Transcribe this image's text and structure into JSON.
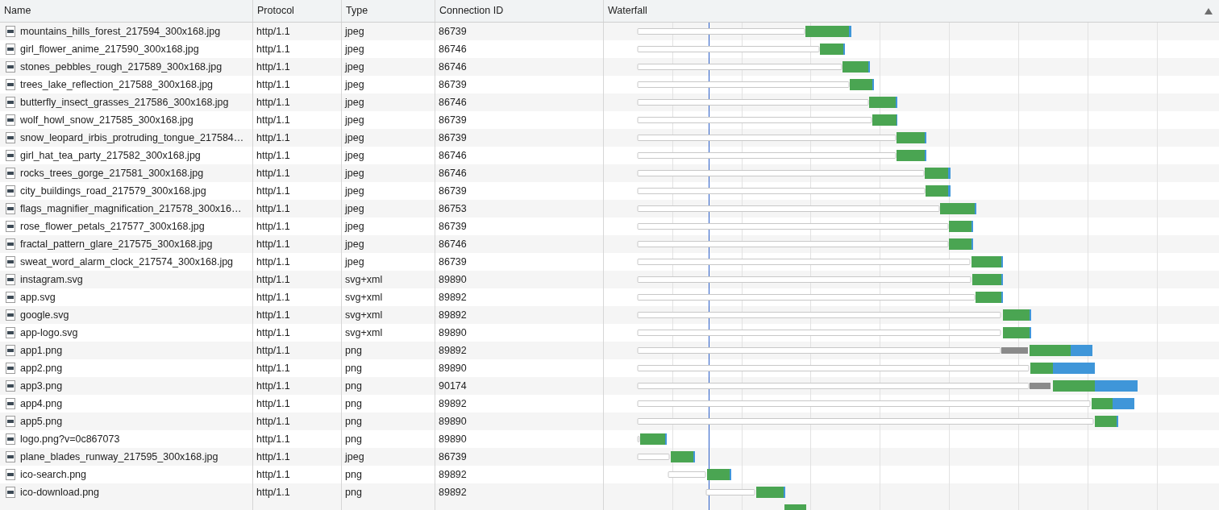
{
  "table": {
    "columns": [
      "Name",
      "Protocol",
      "Type",
      "Connection ID",
      "Waterfall"
    ],
    "sort_ascending": true,
    "rows": [
      {
        "name": "mountains_hills_forest_217594_300x168.jpg",
        "protocol": "http/1.1",
        "type": "jpeg",
        "connection_id": "86739"
      },
      {
        "name": "girl_flower_anime_217590_300x168.jpg",
        "protocol": "http/1.1",
        "type": "jpeg",
        "connection_id": "86746"
      },
      {
        "name": "stones_pebbles_rough_217589_300x168.jpg",
        "protocol": "http/1.1",
        "type": "jpeg",
        "connection_id": "86746"
      },
      {
        "name": "trees_lake_reflection_217588_300x168.jpg",
        "protocol": "http/1.1",
        "type": "jpeg",
        "connection_id": "86739"
      },
      {
        "name": "butterfly_insect_grasses_217586_300x168.jpg",
        "protocol": "http/1.1",
        "type": "jpeg",
        "connection_id": "86746"
      },
      {
        "name": "wolf_howl_snow_217585_300x168.jpg",
        "protocol": "http/1.1",
        "type": "jpeg",
        "connection_id": "86739"
      },
      {
        "name": "snow_leopard_irbis_protruding_tongue_217584…",
        "protocol": "http/1.1",
        "type": "jpeg",
        "connection_id": "86739"
      },
      {
        "name": "girl_hat_tea_party_217582_300x168.jpg",
        "protocol": "http/1.1",
        "type": "jpeg",
        "connection_id": "86746"
      },
      {
        "name": "rocks_trees_gorge_217581_300x168.jpg",
        "protocol": "http/1.1",
        "type": "jpeg",
        "connection_id": "86746"
      },
      {
        "name": "city_buildings_road_217579_300x168.jpg",
        "protocol": "http/1.1",
        "type": "jpeg",
        "connection_id": "86739"
      },
      {
        "name": "flags_magnifier_magnification_217578_300x16…",
        "protocol": "http/1.1",
        "type": "jpeg",
        "connection_id": "86753"
      },
      {
        "name": "rose_flower_petals_217577_300x168.jpg",
        "protocol": "http/1.1",
        "type": "jpeg",
        "connection_id": "86739"
      },
      {
        "name": "fractal_pattern_glare_217575_300x168.jpg",
        "protocol": "http/1.1",
        "type": "jpeg",
        "connection_id": "86746"
      },
      {
        "name": "sweat_word_alarm_clock_217574_300x168.jpg",
        "protocol": "http/1.1",
        "type": "jpeg",
        "connection_id": "86739"
      },
      {
        "name": "instagram.svg",
        "protocol": "http/1.1",
        "type": "svg+xml",
        "connection_id": "89890"
      },
      {
        "name": "app.svg",
        "protocol": "http/1.1",
        "type": "svg+xml",
        "connection_id": "89892"
      },
      {
        "name": "google.svg",
        "protocol": "http/1.1",
        "type": "svg+xml",
        "connection_id": "89892"
      },
      {
        "name": "app-logo.svg",
        "protocol": "http/1.1",
        "type": "svg+xml",
        "connection_id": "89890"
      },
      {
        "name": "app1.png",
        "protocol": "http/1.1",
        "type": "png",
        "connection_id": "89892"
      },
      {
        "name": "app2.png",
        "protocol": "http/1.1",
        "type": "png",
        "connection_id": "89890"
      },
      {
        "name": "app3.png",
        "protocol": "http/1.1",
        "type": "png",
        "connection_id": "90174"
      },
      {
        "name": "app4.png",
        "protocol": "http/1.1",
        "type": "png",
        "connection_id": "89892"
      },
      {
        "name": "app5.png",
        "protocol": "http/1.1",
        "type": "png",
        "connection_id": "89890"
      },
      {
        "name": "logo.png?v=0c867073",
        "protocol": "http/1.1",
        "type": "png",
        "connection_id": "89890"
      },
      {
        "name": "plane_blades_runway_217595_300x168.jpg",
        "protocol": "http/1.1",
        "type": "jpeg",
        "connection_id": "86739"
      },
      {
        "name": "ico-search.png",
        "protocol": "http/1.1",
        "type": "png",
        "connection_id": "89892"
      },
      {
        "name": "ico-download.png",
        "protocol": "http/1.1",
        "type": "png",
        "connection_id": "89892"
      }
    ]
  }
}
